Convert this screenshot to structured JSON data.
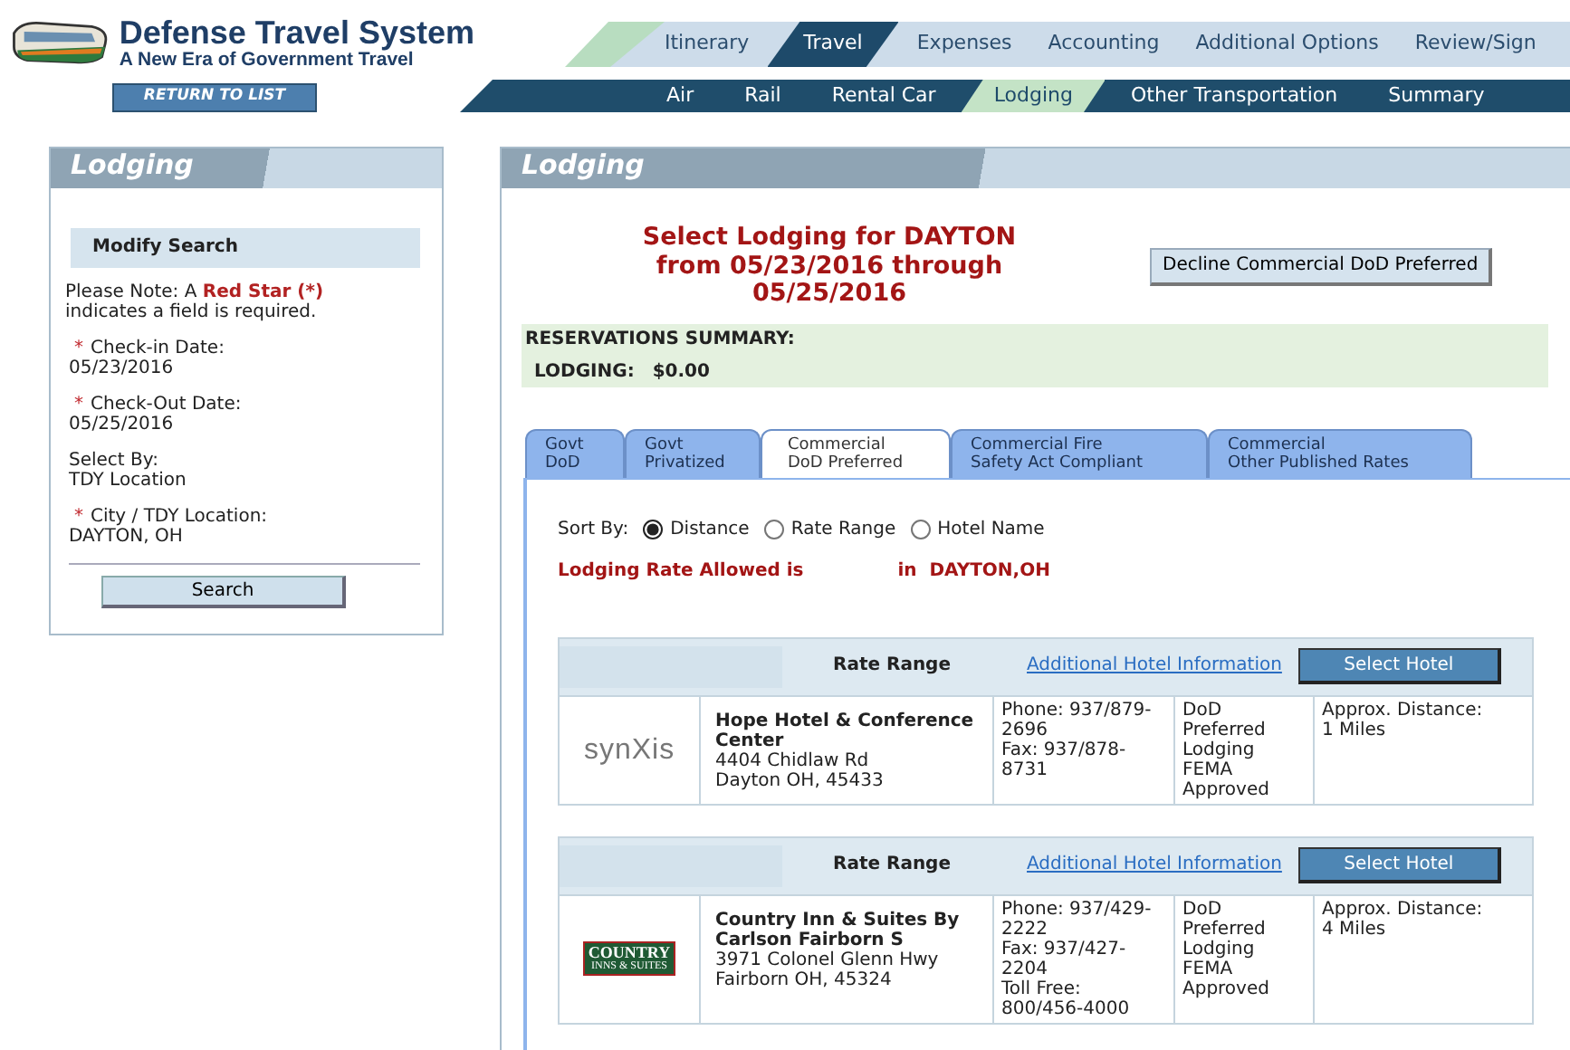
{
  "header": {
    "title": "Defense Travel System",
    "subtitle": "A New Era of Government Travel",
    "return_button": "RETURN TO LIST"
  },
  "main_tabs": [
    {
      "label": "Itinerary",
      "selected": false
    },
    {
      "label": "Travel",
      "selected": true
    },
    {
      "label": "Expenses",
      "selected": false
    },
    {
      "label": "Accounting",
      "selected": false
    },
    {
      "label": "Additional Options",
      "selected": false
    },
    {
      "label": "Review/Sign",
      "selected": false
    }
  ],
  "sub_tabs": [
    {
      "label": "Air",
      "selected": false
    },
    {
      "label": "Rail",
      "selected": false
    },
    {
      "label": "Rental Car",
      "selected": false
    },
    {
      "label": "Lodging",
      "selected": true
    },
    {
      "label": "Other Transportation",
      "selected": false
    },
    {
      "label": "Summary",
      "selected": false
    }
  ],
  "sidebar": {
    "title": "Lodging",
    "section_title": "Modify Search",
    "note": "Please Note: A **Red Star (*)** indicates a field is required.",
    "fields": [
      {
        "star": "*",
        "label": "Check-in Date:",
        "value": "05/23/2016"
      },
      {
        "star": "*",
        "label": "Check-Out Date:",
        "value": "05/25/2016"
      },
      {
        "label": "Select By:",
        "value": "TDY Location"
      },
      {
        "star": "*",
        "label": "City / TDY Location:",
        "value": "DAYTON, OH"
      }
    ],
    "search_button": "Search"
  },
  "main": {
    "title": "Lodging",
    "heading": "Select Lodging for DAYTON from 05/23/2016 through 05/25/2016",
    "decline_button": "Decline Commercial DoD Preferred",
    "summary": {
      "title": "RESERVATIONS SUMMARY:",
      "label": "LODGING:",
      "amount": "$0.00"
    },
    "tabs": [
      {
        "lines": [
          "Govt",
          "DoD"
        ],
        "selected": false
      },
      {
        "lines": [
          "Govt",
          "Privatized"
        ],
        "selected": false
      },
      {
        "lines": [
          "Commercial",
          "DoD Preferred"
        ],
        "selected": true
      },
      {
        "lines": [
          "Commercial Fire",
          "Safety Act Compliant"
        ],
        "selected": false
      },
      {
        "lines": [
          "Commercial",
          "Other Published Rates"
        ],
        "selected": false
      }
    ],
    "sort": {
      "label": "Sort By:",
      "options": [
        {
          "label": "Distance",
          "selected": true
        },
        {
          "label": "Rate Range",
          "selected": false
        },
        {
          "label": "Hotel Name",
          "selected": false
        }
      ]
    },
    "rate_note": "Lodging Rate Allowed is",
    "rate_location": "in  DAYTON,OH",
    "hotels": [
      {
        "rate_label": "Rate Range",
        "info_link": "Additional Hotel Information",
        "select_button": "Select Hotel",
        "logo": {
          "kind": "wordmark",
          "lines": [
            "synXis"
          ]
        },
        "name": "Hope Hotel & Conference Center",
        "address": [
          "4404 Chidlaw Rd",
          "Dayton OH, 45433"
        ],
        "contact": [
          "Phone: 937/879-2696",
          "Fax: 937/878-8731"
        ],
        "program": [
          "DoD Preferred Lodging",
          "FEMA Approved"
        ],
        "distance": [
          "Approx. Distance:",
          "1 Miles"
        ]
      },
      {
        "rate_label": "Rate Range",
        "info_link": "Additional Hotel Information",
        "select_button": "Select Hotel",
        "logo": {
          "kind": "sign",
          "lines": [
            "COUNTRY",
            "INNS & SUITES"
          ]
        },
        "name": "Country Inn & Suites By Carlson Fairborn S",
        "address": [
          "3971 Colonel Glenn Hwy",
          "Fairborn OH, 45324"
        ],
        "contact": [
          "Phone: 937/429-2222",
          "Fax: 937/427-2204",
          "Toll Free: 800/456-4000"
        ],
        "program": [
          "DoD Preferred Lodging",
          "FEMA Approved"
        ],
        "distance": [
          "Approx. Distance:",
          "4 Miles"
        ]
      }
    ]
  }
}
